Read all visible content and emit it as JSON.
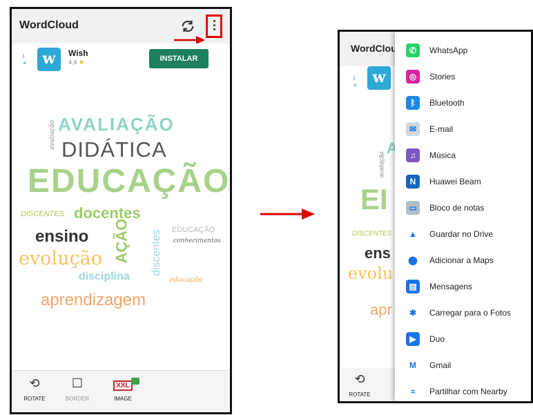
{
  "app": {
    "title": "WordCloud",
    "title_truncated": "WordClou"
  },
  "ad": {
    "name": "Wish",
    "rating": "4,4",
    "install_label": "INSTALAR",
    "info_icon": "i",
    "close_icon": "×"
  },
  "cloud": {
    "words": [
      "AVALIAÇÃO",
      "DIDÁTICA",
      "EDUCAÇÃO",
      "DISCENTES",
      "docentes",
      "ensino",
      "AÇÃO",
      "EDUCAÇÃO",
      "conhecimentos",
      "evolução",
      "discentes",
      "disciplina",
      "educação",
      "aprendizagem",
      "educação",
      "avaliação"
    ],
    "partial_right": [
      "A",
      "EI",
      "DISCENTES",
      "ens",
      "evolu",
      "apr"
    ]
  },
  "bottom": {
    "rotate": "ROTATE",
    "border": "BORDER",
    "image": "IMAGE",
    "xxl": "XXL"
  },
  "share_menu": [
    {
      "label": "WhatsApp",
      "icon": "whatsapp-icon",
      "color": "#25d366",
      "glyph": "✆"
    },
    {
      "label": "Stories",
      "icon": "instagram-icon",
      "color": "#d6249f",
      "glyph": "◎"
    },
    {
      "label": "Bluetooth",
      "icon": "bluetooth-icon",
      "color": "#1e88e5",
      "glyph": "ᛒ"
    },
    {
      "label": "E-mail",
      "icon": "email-icon",
      "color": "#cfd8dc",
      "glyph": "✉"
    },
    {
      "label": "Música",
      "icon": "music-icon",
      "color": "#7e57c2",
      "glyph": "♫"
    },
    {
      "label": "Huawei Beam",
      "icon": "nfc-icon",
      "color": "#1565c0",
      "glyph": "N"
    },
    {
      "label": "Bloco de notas",
      "icon": "notes-icon",
      "color": "#b0bec5",
      "glyph": "▭"
    },
    {
      "label": "Guardar no Drive",
      "icon": "drive-icon",
      "color": "#ffffff",
      "glyph": "▲"
    },
    {
      "label": "Adicionar a Maps",
      "icon": "maps-icon",
      "color": "#ffffff",
      "glyph": "⬤"
    },
    {
      "label": "Mensagens",
      "icon": "messages-icon",
      "color": "#1a73e8",
      "glyph": "▤"
    },
    {
      "label": "Carregar para o Fotos",
      "icon": "photos-icon",
      "color": "#ffffff",
      "glyph": "✱"
    },
    {
      "label": "Duo",
      "icon": "duo-icon",
      "color": "#1a73e8",
      "glyph": "▶"
    },
    {
      "label": "Gmail",
      "icon": "gmail-icon",
      "color": "#ffffff",
      "glyph": "M"
    },
    {
      "label": "Partilhar com Nearby",
      "icon": "nearby-icon",
      "color": "#ffffff",
      "glyph": "≈"
    }
  ]
}
